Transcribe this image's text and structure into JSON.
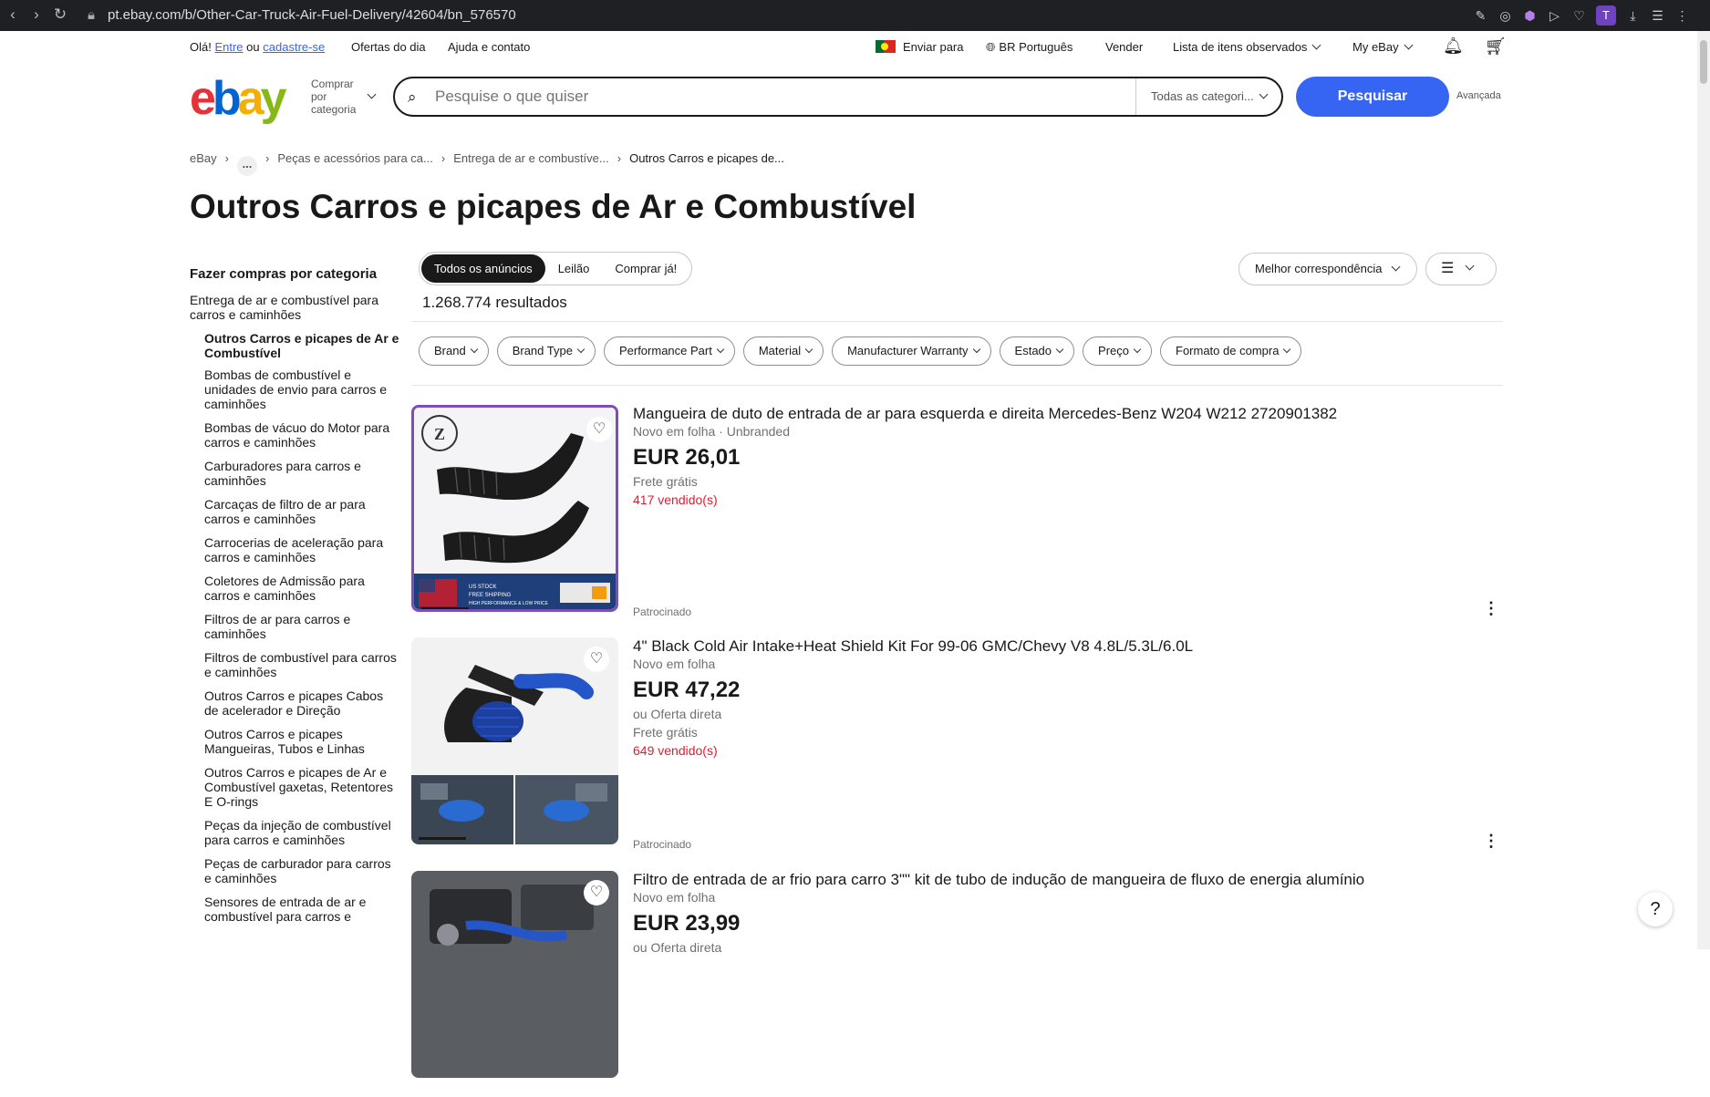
{
  "browser": {
    "url": "pt.ebay.com/b/Other-Car-Truck-Air-Fuel-Delivery/42604/bn_576570",
    "profile_initial": "T"
  },
  "topbar": {
    "greeting": "Olá!",
    "signin": "Entre",
    "or": "ou",
    "register": "cadastre-se",
    "daily_deals": "Ofertas do dia",
    "help": "Ajuda e contato",
    "ship_to": "Enviar para",
    "language": "BR Português",
    "sell": "Vender",
    "watchlist": "Lista de itens observados",
    "my_ebay": "My eBay"
  },
  "header": {
    "logo": {
      "e": "e",
      "b": "b",
      "a": "a",
      "y": "y"
    },
    "shop_by_category": "Comprar por categoria",
    "search_placeholder": "Pesquise o que quiser",
    "category_select": "Todas as categori...",
    "search_button": "Pesquisar",
    "advanced": "Avançada"
  },
  "breadcrumb": [
    "eBay",
    "...",
    "Peças e acessórios para ca...",
    "Entrega de ar e combustíve...",
    "Outros Carros e picapes de..."
  ],
  "page_title": "Outros Carros e picapes de Ar e Combustível",
  "sidebar": {
    "heading": "Fazer compras por categoria",
    "parent": "Entrega de ar e combustível para carros e caminhões",
    "current": "Outros Carros e picapes de Ar e Combustível",
    "items": [
      "Bombas de combustível e unidades de envio para carros e caminhões",
      "Bombas de vácuo do Motor para carros e caminhões",
      "Carburadores para carros e caminhões",
      "Carcaças de filtro de ar para carros e caminhões",
      "Carrocerias de aceleração para carros e caminhões",
      "Coletores de Admissão para carros e caminhões",
      "Filtros de ar para carros e caminhões",
      "Filtros de combustível para carros e caminhões",
      "Outros Carros e picapes Cabos de acelerador e Direção",
      "Outros Carros e picapes Mangueiras, Tubos e Linhas",
      "Outros Carros e picapes de Ar e Combustível gaxetas, Retentores E O-rings",
      "Peças da injeção de combustível para carros e caminhões",
      "Peças de carburador para carros e caminhões",
      "Sensores de entrada de ar e combustível para carros e"
    ]
  },
  "listing_tabs": [
    {
      "label": "Todos os anúncios",
      "active": true
    },
    {
      "label": "Leilão",
      "active": false
    },
    {
      "label": "Comprar já!",
      "active": false
    }
  ],
  "results_count": "1.268.774 resultados",
  "sort": "Melhor correspondência",
  "filters": [
    "Brand",
    "Brand Type",
    "Performance Part",
    "Material",
    "Manufacturer Warranty",
    "Estado",
    "Preço",
    "Formato de compra"
  ],
  "items": [
    {
      "title": "Mangueira de duto de entrada de ar para esquerda e direita Mercedes-Benz W204 W212 2720901382",
      "condition": "Novo em folha · Unbranded",
      "price": "EUR 26,01",
      "offer": "",
      "shipping": "Frete grátis",
      "sold": "417 vendido(s)",
      "sponsored": "Patrocinado",
      "image_text": [
        "US STOCK",
        "FREE SHIPPING",
        "HIGH PERFORMANCE & LOW PRICE"
      ]
    },
    {
      "title": "4\" Black Cold Air Intake+Heat Shield Kit For 99-06 GMC/Chevy V8 4.8L/5.3L/6.0L",
      "condition": "Novo em folha",
      "price": "EUR 47,22",
      "offer": "ou Oferta direta",
      "shipping": "Frete grátis",
      "sold": "649 vendido(s)",
      "sponsored": "Patrocinado"
    },
    {
      "title": "Filtro de entrada de ar frio para carro 3\"\" kit de tubo de indução de mangueira de fluxo de energia alumínio",
      "condition": "Novo em folha",
      "price": "EUR 23,99",
      "offer": "ou Oferta direta"
    }
  ],
  "help_label": "?"
}
